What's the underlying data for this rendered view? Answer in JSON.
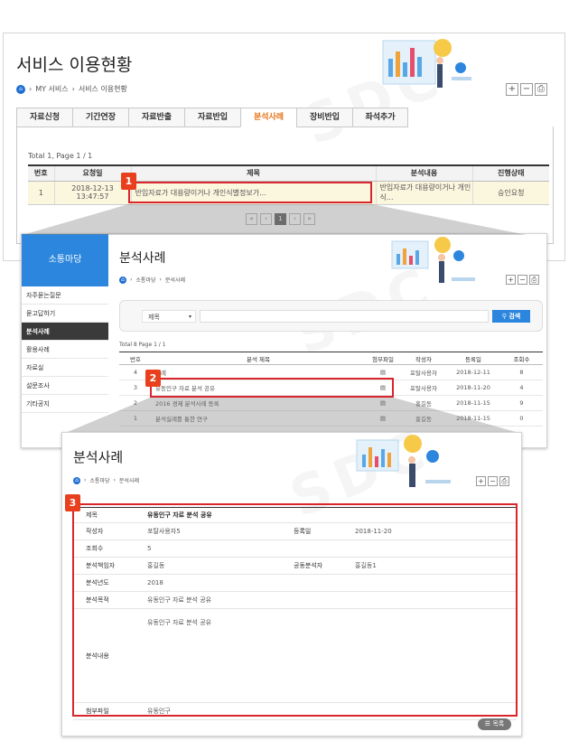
{
  "panel1": {
    "title": "서비스 이용현황",
    "breadcrumb": [
      "MY 서비스",
      "서비스 이용현황"
    ],
    "zoom_in": "+",
    "zoom_out": "−",
    "tabs": [
      "자료신청",
      "기간연장",
      "자료반출",
      "자료반입",
      "분석사례",
      "장비반입",
      "좌석추가"
    ],
    "active_tab": "분석사례",
    "total_text": "Total 1,  Page 1 / 1",
    "columns": [
      "번호",
      "요청일",
      "제목",
      "분석내용",
      "진행상태"
    ],
    "row": {
      "no": "1",
      "date": "2018-12-13 13:47:57",
      "title": "반입자료가 대용량이거나 개인식별정보가...",
      "content": "반입자료가 대용량이거나 개인식...",
      "status": "승인요청"
    },
    "pager": [
      "«",
      "‹",
      "1",
      "›",
      "»"
    ]
  },
  "panel2": {
    "sidebar_title": "소통마당",
    "sidebar_items": [
      "자주묻는질문",
      "묻고답하기",
      "분석사례",
      "활용사례",
      "자료실",
      "설문조사",
      "기타공지"
    ],
    "active_item": "분석사례",
    "title": "분석사례",
    "breadcrumb": [
      "소통마당",
      "분석사례"
    ],
    "search_select": "제목",
    "search_button": "검색",
    "total_text": "Total 8 Page 1 / 1",
    "columns": [
      "번호",
      "분석 제목",
      "첨부파일",
      "작성자",
      "등록일",
      "조회수"
    ],
    "rows": [
      {
        "no": "4",
        "title": "사례",
        "writer": "포탈사용자",
        "date": "2018-12-11",
        "views": "8"
      },
      {
        "no": "3",
        "title": "유동인구 자료 분석 공유",
        "writer": "포탈사용자",
        "date": "2018-11-20",
        "views": "4"
      },
      {
        "no": "2",
        "title": "2016 경제 분석사례 등록",
        "writer": "홍길동",
        "date": "2018-11-15",
        "views": "9"
      },
      {
        "no": "1",
        "title": "분석실례를 통한 연구",
        "writer": "홍길동",
        "date": "2018-11-15",
        "views": "0"
      }
    ]
  },
  "panel3": {
    "title": "분석사례",
    "breadcrumb": [
      "소통마당",
      "분석사례"
    ],
    "fields": {
      "subject_label": "제목",
      "subject": "유동인구 자료 분석 공유",
      "writer_label": "작성자",
      "writer": "포탈사용자5",
      "regdate_label": "등록일",
      "regdate": "2018-11-20",
      "views_label": "조회수",
      "views": "5",
      "manager_label": "분석책임자",
      "manager": "홍길동",
      "co_label": "공동분석자",
      "co": "홍길동1",
      "year_label": "분석년도",
      "year": "2018",
      "purpose_label": "분석목적",
      "purpose": "유동인구 자료 분석 공유",
      "body_label": "분석내용",
      "body": "유동인구 자료 분석 공유",
      "file_label": "첨부파일",
      "file": "유동인구"
    },
    "list_button": "목록"
  },
  "markers": [
    "1",
    "2",
    "3"
  ],
  "colors": {
    "accent_blue": "#2c86dd",
    "highlight_red": "#d9252b",
    "tab_active": "#e8751a",
    "row_highlight": "#fbf6de"
  }
}
